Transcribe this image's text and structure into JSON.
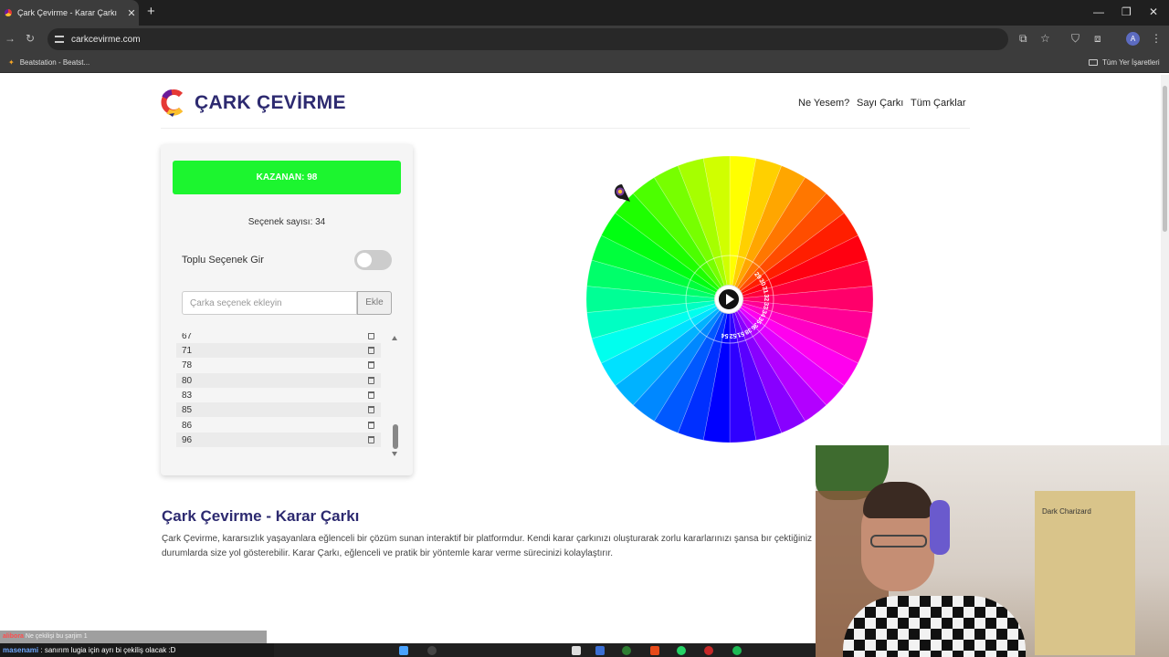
{
  "browser": {
    "tab_title": "Çark Çevirme - Karar Çarkı",
    "url": "carkcevirme.com",
    "bookmark": "Beatstation - Beatst...",
    "all_bookmarks": "Tüm Yer İşaretleri",
    "profile_initial": "A"
  },
  "site": {
    "title": "ÇARK ÇEVİRME",
    "nav": [
      "Ne Yesem?",
      "Sayı Çarkı",
      "Tüm Çarklar"
    ]
  },
  "panel": {
    "winner": "KAZANAN: 98",
    "option_count": "Seçenek sayısı: 34",
    "bulk_toggle_label": "Toplu Seçenek Gir",
    "bulk_toggle_on": false,
    "input_placeholder": "Çarka seçenek ekleyin",
    "add_button": "Ekle",
    "items": [
      "67",
      "71",
      "78",
      "80",
      "83",
      "85",
      "86",
      "96"
    ]
  },
  "wheel": {
    "segments": 34,
    "visible_numbers": [
      "29",
      "30",
      "31",
      "32",
      "33",
      "34",
      "35",
      "36",
      "38",
      "51",
      "52",
      "54"
    ]
  },
  "article": {
    "title": "Çark Çevirme - Karar Çarkı",
    "text": "Çark Çevirme, kararsızlık yaşayanlara eğlenceli bir çözüm sunan interaktif bir platformdur. Kendi karar çarkınızı oluşturarak zorlu kararlarınızı şansa bır çektiğiniz durumlarda size yol gösterebilir. Karar Çarkı, eğlenceli ve pratik bir yöntemle karar verme sürecinizi kolaylaştırır."
  },
  "webcam": {
    "poster_text": "Dark Charizard"
  },
  "chat": {
    "line1_user": "alibora",
    "line1_text": "Ne çekilişi bu şarjim 1",
    "line2_user": "masenami",
    "line2_text": ": sanırım lugia için ayrı bi çekiliş olacak :D"
  }
}
